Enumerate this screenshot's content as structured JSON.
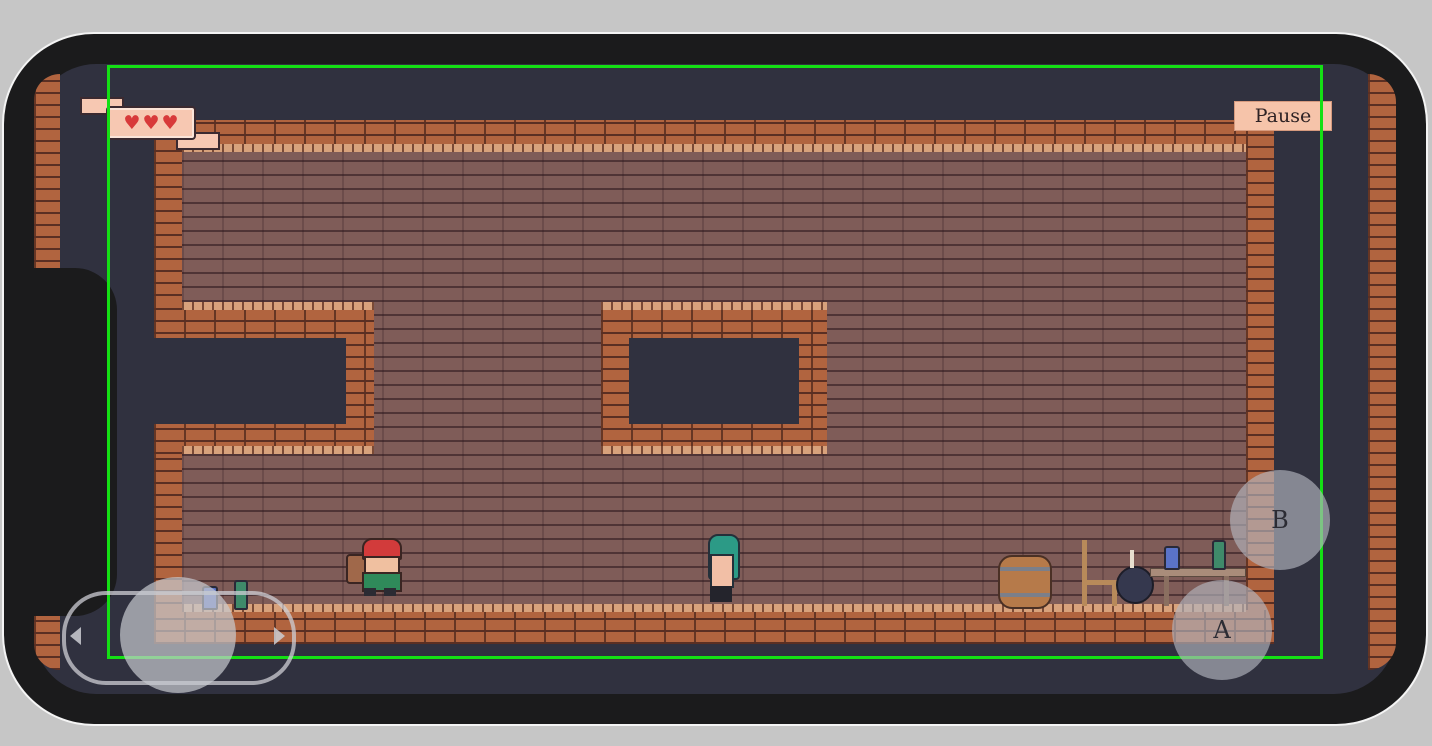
{
  "hud": {
    "hearts": [
      "♥",
      "♥",
      "♥"
    ],
    "pause_label": "Pause"
  },
  "controls": {
    "button_a_label": "A",
    "button_b_label": "B",
    "joystick_left_icon": "arrow-left-icon",
    "joystick_right_icon": "arrow-right-icon"
  },
  "colors": {
    "heart": "#d83a3a",
    "overlay_frame": "#14e014",
    "background": "#30313f"
  },
  "scene": {
    "entities": [
      "player-pirate",
      "whale-enemy",
      "barrel",
      "chair",
      "table",
      "bomb",
      "bottles"
    ]
  }
}
